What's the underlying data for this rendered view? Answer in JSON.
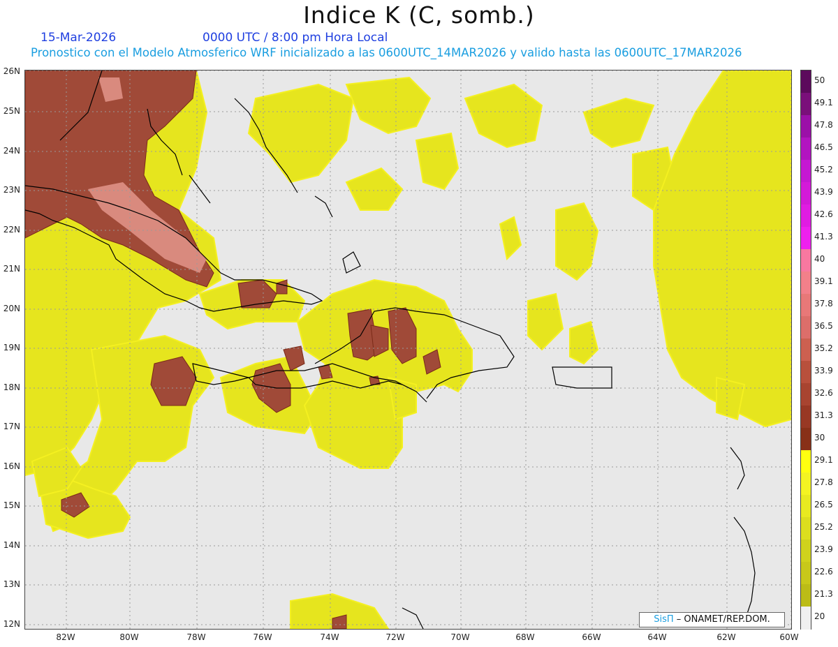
{
  "header": {
    "title": "Indice K (C, somb.)",
    "date": "15-Mar-2026",
    "time": "0000 UTC / 8:00 pm Hora Local",
    "subtitle": "Pronostico con el Modelo Atmosferico WRF inicializado a las 0600UTC_14MAR2026 y valido hasta las  0600UTC_17MAR2026"
  },
  "map": {
    "lat_labels": [
      "26N",
      "25N",
      "24N",
      "23N",
      "22N",
      "21N",
      "20N",
      "19N",
      "18N",
      "17N",
      "16N",
      "15N",
      "14N",
      "13N",
      "12N"
    ],
    "lon_labels": [
      "82W",
      "80W",
      "78W",
      "76W",
      "74W",
      "72W",
      "70W",
      "68W",
      "66W",
      "64W",
      "62W",
      "60W"
    ],
    "background_color": "#e8e8e8",
    "coastline_color": "#000000"
  },
  "colorbar": {
    "labels": [
      "50",
      "49.1",
      "47.8",
      "46.5",
      "45.2",
      "43.9",
      "42.6",
      "41.3",
      "40",
      "39.1",
      "37.8",
      "36.5",
      "35.2",
      "33.9",
      "32.6",
      "31.3",
      "30",
      "29.1",
      "27.8",
      "26.5",
      "25.2",
      "23.9",
      "22.6",
      "21.3",
      "20"
    ],
    "colors": [
      "#5c0a5c",
      "#7a0f7a",
      "#9b10a8",
      "#b214c0",
      "#c518d2",
      "#d31ad8",
      "#e01ce2",
      "#ee20ee",
      "#f878a0",
      "#f2808a",
      "#e87878",
      "#dc6e6a",
      "#cc6050",
      "#b8503c",
      "#a84430",
      "#983824",
      "#883018",
      "#ffff10",
      "#f4f422",
      "#e8ea20",
      "#dcde1e",
      "#d0d21c",
      "#c8c81a",
      "#bcbc16",
      "#f0f0f0"
    ]
  },
  "credit": {
    "brand": "SisΠ",
    "org": " – ONAMET/REP.DOM."
  }
}
